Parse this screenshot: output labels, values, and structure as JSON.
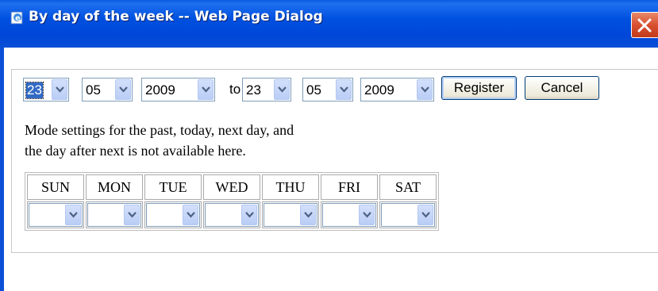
{
  "window": {
    "title": "By day of the week -- Web Page Dialog"
  },
  "range": {
    "from_day": "23",
    "from_month": "05",
    "from_year": "2009",
    "separator": "to",
    "to_day": "23",
    "to_month": "05",
    "to_year": "2009"
  },
  "buttons": {
    "register": "Register",
    "cancel": "Cancel"
  },
  "notice": {
    "line1": "Mode settings for the past, today, next day, and",
    "line2": "the day after next is not available here."
  },
  "days": [
    "SUN",
    "MON",
    "TUE",
    "WED",
    "THU",
    "FRI",
    "SAT"
  ],
  "day_values": [
    "",
    "",
    "",
    "",
    "",
    "",
    ""
  ],
  "icons": {
    "title": "ie-page-icon",
    "close": "close-x-icon",
    "dropdown": "chevron-down-icon"
  },
  "colors": {
    "titlebar": "#0050e0",
    "close": "#d8502f",
    "selection": "#316ac5"
  }
}
